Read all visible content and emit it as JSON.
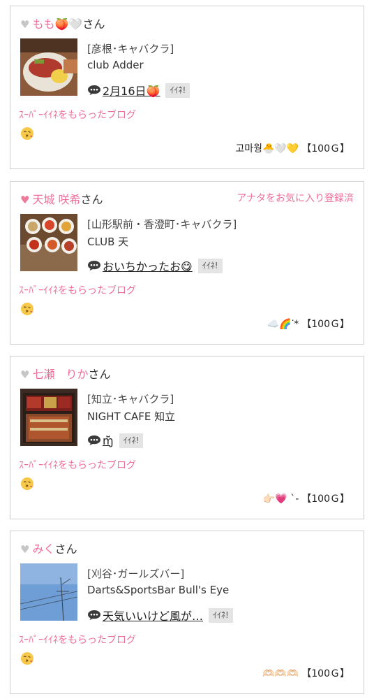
{
  "posts": [
    {
      "user_name": "もも🍑🤍",
      "san_suffix": "さん",
      "favorite_note": "",
      "shop_area": "[彦根･キャバクラ]",
      "shop_name": "club Adder",
      "blog_title": "2月16日🍑",
      "iine_label": "ｲｲﾈ!",
      "super_label": "ｽｰﾊﾟｰｲｲﾈをもらったブログ",
      "gift_message": "고마웡🐣🤍💛",
      "gift_price": "【100Ｇ】",
      "heart_color": "gray"
    },
    {
      "user_name": "天城 咲希",
      "san_suffix": "さん",
      "favorite_note": "アナタをお気に入り登録済",
      "shop_area": "[山形駅前・香澄町･キャバクラ]",
      "shop_name": "CLUB 天",
      "blog_title": "おいちかったお😋",
      "iine_label": "ｲｲﾈ!",
      "super_label": "ｽｰﾊﾟｰｲｲﾈをもらったブログ",
      "gift_message": "☁️🌈ᐝ*",
      "gift_price": "【100Ｇ】",
      "heart_color": "pink"
    },
    {
      "user_name": "七瀬　りか",
      "san_suffix": "さん",
      "favorite_note": "",
      "shop_area": "[知立･キャバクラ]",
      "shop_name": "NIGHT CAFE 知立",
      "blog_title": "ɱ̆̈",
      "iine_label": "ｲｲﾈ!",
      "super_label": "ｽｰﾊﾟｰｲｲﾈをもらったブログ",
      "gift_message": "👉🏻💗 ˋ-",
      "gift_price": "【100Ｇ】",
      "heart_color": "gray"
    },
    {
      "user_name": "みく",
      "san_suffix": "さん",
      "favorite_note": "",
      "shop_area": "[刈谷･ガールズバー]",
      "shop_name": "Darts&SportsBar Bull's Eye",
      "blog_title": "天気いいけど風が…",
      "iine_label": "ｲｲﾈ!",
      "super_label": "ｽｰﾊﾟｰｲｲﾈをもらったブログ",
      "gift_message": "🫶🏻🫶🏻🫶🏻",
      "gift_price": "【100Ｇ】",
      "heart_color": "gray"
    }
  ],
  "icons": {
    "heart": "heart-icon",
    "speech_bubble": "speech-bubble-icon",
    "super_emoji": "kiss-face-emoji-icon"
  }
}
